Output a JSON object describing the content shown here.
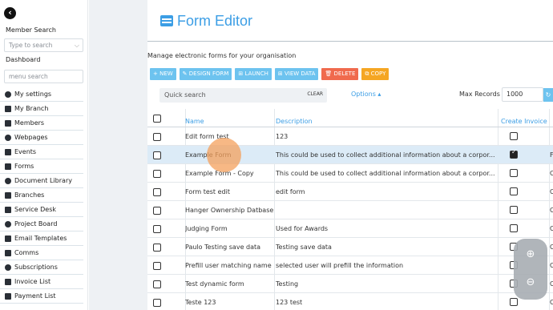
{
  "sidebar": {
    "member_search_label": "Member Search",
    "member_search_placeholder": "Type to search",
    "dashboard_label": "Dashboard",
    "menu_search_placeholder": "menu search",
    "items": [
      {
        "label": "My settings",
        "icon": "users-icon"
      },
      {
        "label": "My Branch",
        "icon": "building-icon"
      },
      {
        "label": "Members",
        "icon": "id-card-icon"
      },
      {
        "label": "Webpages",
        "icon": "globe-icon"
      },
      {
        "label": "Events",
        "icon": "calendar-icon"
      },
      {
        "label": "Forms",
        "icon": "table-icon"
      },
      {
        "label": "Document Library",
        "icon": "file-icon"
      },
      {
        "label": "Branches",
        "icon": "building-icon"
      },
      {
        "label": "Service Desk",
        "icon": "headset-icon"
      },
      {
        "label": "Project Board",
        "icon": "sitemap-icon"
      },
      {
        "label": "Email Templates",
        "icon": "envelope-icon"
      },
      {
        "label": "Comms",
        "icon": "comment-icon"
      },
      {
        "label": "Subscriptions",
        "icon": "users-icon"
      },
      {
        "label": "Invoice List",
        "icon": "file-invoice-icon"
      },
      {
        "label": "Payment List",
        "icon": "credit-card-icon"
      }
    ]
  },
  "header": {
    "title": "Form Editor",
    "subtitle": "Manage electronic forms for your organisation"
  },
  "toolbar": {
    "new_label": "+ NEW",
    "design_form_label": "✎ DESIGN FORM",
    "launch_label": "⊞ LAUNCH",
    "view_data_label": "⊞ VIEW DATA",
    "delete_label": "🗑 DELETE",
    "copy_label": "⧉ COPY"
  },
  "search": {
    "placeholder": "Quick search",
    "clear_label": "CLEAR",
    "options_label": "Options ▴",
    "max_records_label": "Max Records",
    "max_records_value": "1000"
  },
  "table": {
    "headers": {
      "name": "Name",
      "description": "Description",
      "create_invoice": "Create Invoice"
    },
    "rows": [
      {
        "name": "Edit form test",
        "description": "123",
        "invoice": false,
        "extra": "",
        "selected": false
      },
      {
        "name": "Example Form",
        "description": "This could be used to collect additional information about a corpor...",
        "invoice": true,
        "extra": "F",
        "selected": true
      },
      {
        "name": "Example Form - Copy",
        "description": "This could be used to collect additional information about a corpor...",
        "invoice": false,
        "extra": "C",
        "selected": false
      },
      {
        "name": "Form test edit",
        "description": "edit form",
        "invoice": false,
        "extra": "C",
        "selected": false
      },
      {
        "name": "Hanger Ownership Datbase test",
        "description": "",
        "invoice": false,
        "extra": "C",
        "selected": false
      },
      {
        "name": "Judging Form",
        "description": "Used for Awards",
        "invoice": false,
        "extra": "C",
        "selected": false
      },
      {
        "name": "Paulo Testing save data",
        "description": "Testing save data",
        "invoice": false,
        "extra": "C",
        "selected": false
      },
      {
        "name": "Prefill user matching name",
        "description": "selected user will prefill the information",
        "invoice": false,
        "extra": "C",
        "selected": false
      },
      {
        "name": "Test dynamic form",
        "description": "Testing",
        "invoice": false,
        "extra": "C",
        "selected": false
      },
      {
        "name": "Teste 123",
        "description": "123 test",
        "invoice": false,
        "extra": "C",
        "selected": false
      }
    ]
  },
  "zoom": {
    "zoom_in": "⊕",
    "zoom_out": "⊖"
  }
}
